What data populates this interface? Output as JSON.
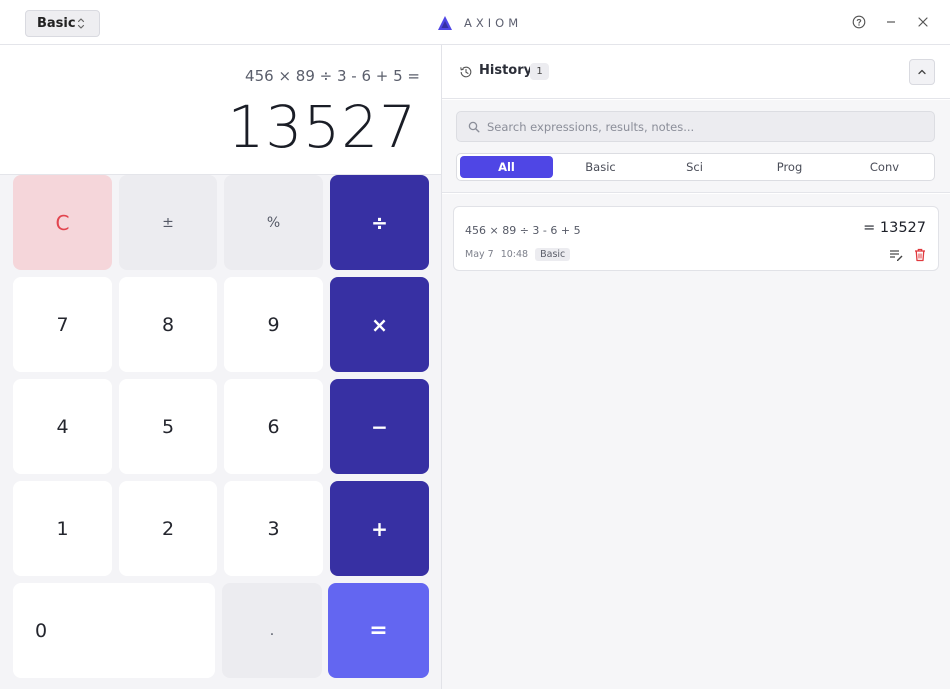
{
  "titlebar": {
    "mode": "Basic",
    "brand": "AXIOM",
    "help_icon": "help-circle-icon",
    "minimize_icon": "minimize-icon",
    "close_icon": "close-icon"
  },
  "display": {
    "expression": "456 × 89 ÷ 3 - 6 + 5 =",
    "result": "13527"
  },
  "keypad": {
    "clear": "C",
    "sign": "±",
    "percent": "%",
    "divide": "÷",
    "seven": "7",
    "eight": "8",
    "nine": "9",
    "multiply": "×",
    "four": "4",
    "five": "5",
    "six": "6",
    "subtract": "−",
    "one": "1",
    "two": "2",
    "three": "3",
    "add": "+",
    "zero": "0",
    "decimal": ".",
    "equals": "="
  },
  "history": {
    "title": "History",
    "count": "1",
    "search_placeholder": "Search expressions, results, notes...",
    "tabs": [
      "All",
      "Basic",
      "Sci",
      "Prog",
      "Conv"
    ],
    "active_tab": "All",
    "items": [
      {
        "expression": "456 × 89 ÷ 3 - 6 + 5",
        "result": "= 13527",
        "date": "May 7",
        "time": "10:48",
        "tag": "Basic"
      }
    ]
  },
  "colors": {
    "operator": "#3730a3",
    "equals": "#6366f1",
    "active_tab": "#4f46e5",
    "clear_bg": "#f5d6da",
    "clear_text": "#e2454f",
    "delete_icon": "#e0393e"
  }
}
